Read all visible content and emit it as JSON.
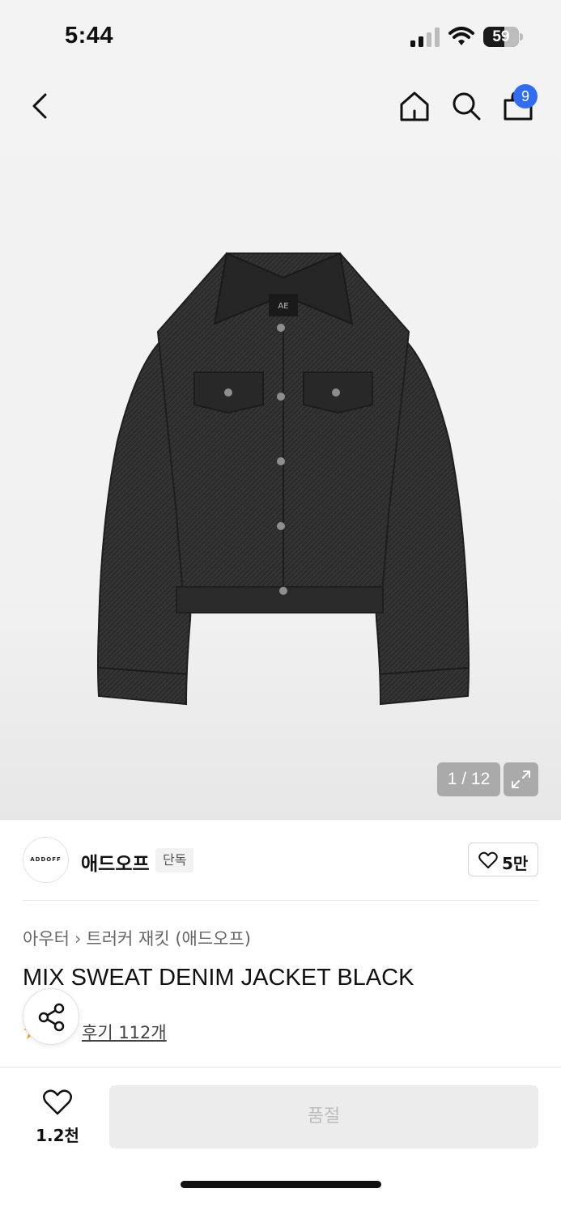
{
  "status_bar": {
    "time": "5:44",
    "battery_level": "59",
    "battery_fraction": 0.59
  },
  "header": {
    "back_icon": "chevron-left-icon",
    "home_icon": "home-icon",
    "search_icon": "search-icon",
    "cart_icon": "shopping-bag-icon",
    "cart_badge": "9",
    "badge_color": "#2f6df2"
  },
  "gallery": {
    "counter": "1 / 12",
    "expand_icon": "expand-icon",
    "jacket_logo_text": "AE"
  },
  "brand": {
    "logo_text": "ADDOFF",
    "name": "애드오프",
    "badge": "단독",
    "like_count": "5만"
  },
  "product": {
    "breadcrumb": [
      "아우터",
      "트러커 재킷 (애드오프)"
    ],
    "title": "MIX SWEAT DENIM JACKET BLACK",
    "review_label": "후기 112개"
  },
  "bottom_bar": {
    "wish_count": "1.2천",
    "soldout_label": "품절"
  }
}
